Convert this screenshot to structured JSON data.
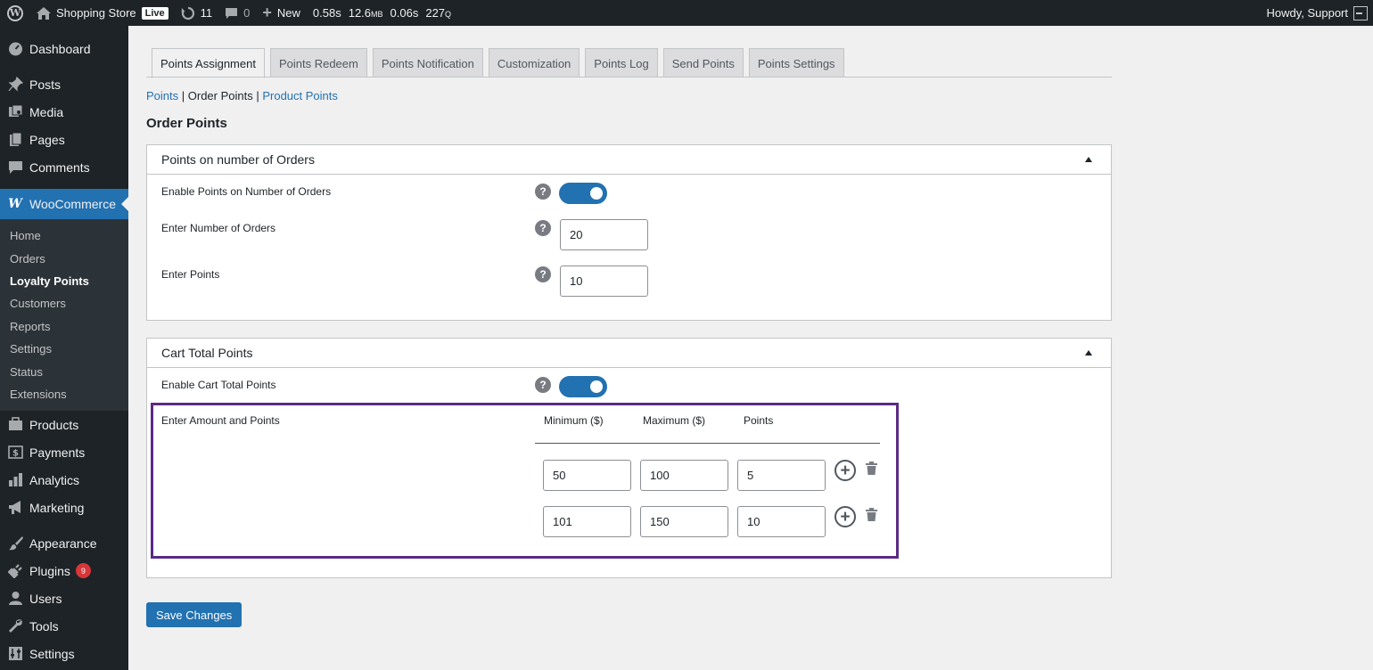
{
  "adminbar": {
    "site_name": "Shopping Store",
    "live_badge": "Live",
    "updates_count": "11",
    "comments_count": "0",
    "new_label": "New",
    "metric_time1": "0.58s",
    "metric_mem": "12.6",
    "metric_mem_unit": "MB",
    "metric_time2": "0.06s",
    "metric_queries": "227",
    "metric_queries_unit": "Q",
    "howdy": "Howdy, Support"
  },
  "sidebar": {
    "dashboard": "Dashboard",
    "posts": "Posts",
    "media": "Media",
    "pages": "Pages",
    "comments": "Comments",
    "woocommerce": "WooCommerce",
    "submenu": [
      "Home",
      "Orders",
      "Loyalty Points",
      "Customers",
      "Reports",
      "Settings",
      "Status",
      "Extensions"
    ],
    "products": "Products",
    "payments": "Payments",
    "analytics": "Analytics",
    "marketing": "Marketing",
    "appearance": "Appearance",
    "plugins": "Plugins",
    "plugins_badge": "9",
    "users": "Users",
    "tools": "Tools",
    "settings": "Settings"
  },
  "tabs": [
    "Points Assignment",
    "Points Redeem",
    "Points Notification",
    "Customization",
    "Points Log",
    "Send Points",
    "Points Settings"
  ],
  "breadcrumb": {
    "points": "Points",
    "sep1": " | ",
    "order_points": "Order Points",
    "sep2": " | ",
    "product_points": "Product Points"
  },
  "page_title": "Order Points",
  "orders_panel": {
    "title": "Points on number of Orders",
    "enable_label": "Enable Points on Number of Orders",
    "enabled": true,
    "num_orders_label": "Enter Number of Orders",
    "num_orders_value": "20",
    "points_label": "Enter Points",
    "points_value": "10"
  },
  "cart_panel": {
    "title": "Cart Total Points",
    "enable_label": "Enable Cart Total Points",
    "enabled": true,
    "amount_label": "Enter Amount and Points",
    "col_min": "Minimum ($)",
    "col_max": "Maximum ($)",
    "col_points": "Points",
    "rows": [
      {
        "min": "50",
        "max": "100",
        "points": "5"
      },
      {
        "min": "101",
        "max": "150",
        "points": "10"
      }
    ]
  },
  "help_glyph": "?",
  "add_glyph": "+",
  "save_label": "Save Changes",
  "colors": {
    "accent": "#2271b1",
    "highlight_border": "#5b2a86",
    "sidebar_bg": "#1d2327",
    "badge": "#d63638"
  }
}
